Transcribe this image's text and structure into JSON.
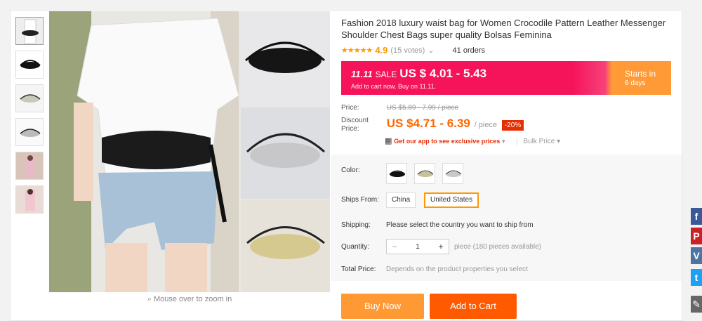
{
  "product": {
    "title": "Fashion 2018 luxury waist bag for Women Crocodile Pattern Leather Messenger Shoulder Chest Bags super quality Bolsas Feminina",
    "rating": "4.9",
    "votes": "(15 votes)",
    "orders": "41 orders"
  },
  "gallery": {
    "zoom_hint": "Mouse over to zoom in"
  },
  "sale_banner": {
    "event": "11.11",
    "sale_label": "SALE",
    "price": "US $ 4.01 - 5.43",
    "sub": "Add to cart now. Buy on 11.11.",
    "starts_in_label": "Starts in",
    "starts_in_value": "6 days"
  },
  "pricing": {
    "price_label": "Price:",
    "original_price": "US $5.89 - 7.99 / piece",
    "discount_label_1": "Discount",
    "discount_label_2": "Price:",
    "discount_price": "US $4.71 - 6.39",
    "per_piece": "/ piece",
    "discount_pct": "-20%",
    "app_promo": "Get our app to see exclusive prices",
    "bulk_price": "Bulk Price"
  },
  "options": {
    "color_label": "Color:",
    "ships_from_label": "Ships From:",
    "ships_from_options": [
      "China",
      "United States"
    ],
    "ships_from_selected": "United States",
    "shipping_label": "Shipping:",
    "shipping_text": "Please select the country you want to ship from",
    "quantity_label": "Quantity:",
    "quantity_value": "1",
    "quantity_available": "piece (180 pieces available)",
    "total_label": "Total Price:",
    "total_text": "Depends on the product properties you select"
  },
  "actions": {
    "buy_now": "Buy Now",
    "add_to_cart": "Add to Cart"
  },
  "colors": {
    "accent_orange": "#ff9933",
    "cart_orange": "#ff5a00",
    "sale_pink": "#f5135a",
    "price_orange": "#ff6600"
  },
  "social": [
    "f",
    "P",
    "V",
    "t",
    "✎"
  ]
}
